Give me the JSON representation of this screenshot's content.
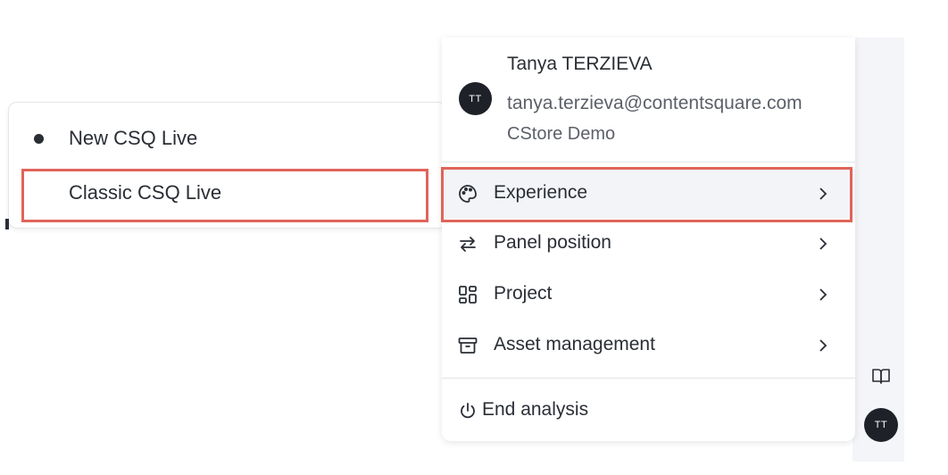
{
  "user": {
    "initials": "TT",
    "name": "Tanya TERZIEVA",
    "email": "tanya.terzieva@contentsquare.com",
    "org": "CStore Demo"
  },
  "menu": {
    "items": [
      {
        "label": "Experience",
        "icon": "palette-icon"
      },
      {
        "label": "Panel position",
        "icon": "swap-arrows-icon"
      },
      {
        "label": "Project",
        "icon": "grid-icon"
      },
      {
        "label": "Asset management",
        "icon": "archive-box-icon"
      }
    ],
    "end_analysis": {
      "label": "End analysis",
      "icon": "power-icon"
    }
  },
  "experience_submenu": {
    "items": [
      {
        "label": "New CSQ Live",
        "selected": true
      },
      {
        "label": "Classic CSQ Live",
        "selected": false
      }
    ]
  },
  "sidebar": {
    "avatar_initials": "TT",
    "book_icon": "book-icon"
  },
  "colors": {
    "highlight": "#e0645a",
    "avatar_bg": "#1e2128",
    "active_bg": "#f3f4f7"
  }
}
